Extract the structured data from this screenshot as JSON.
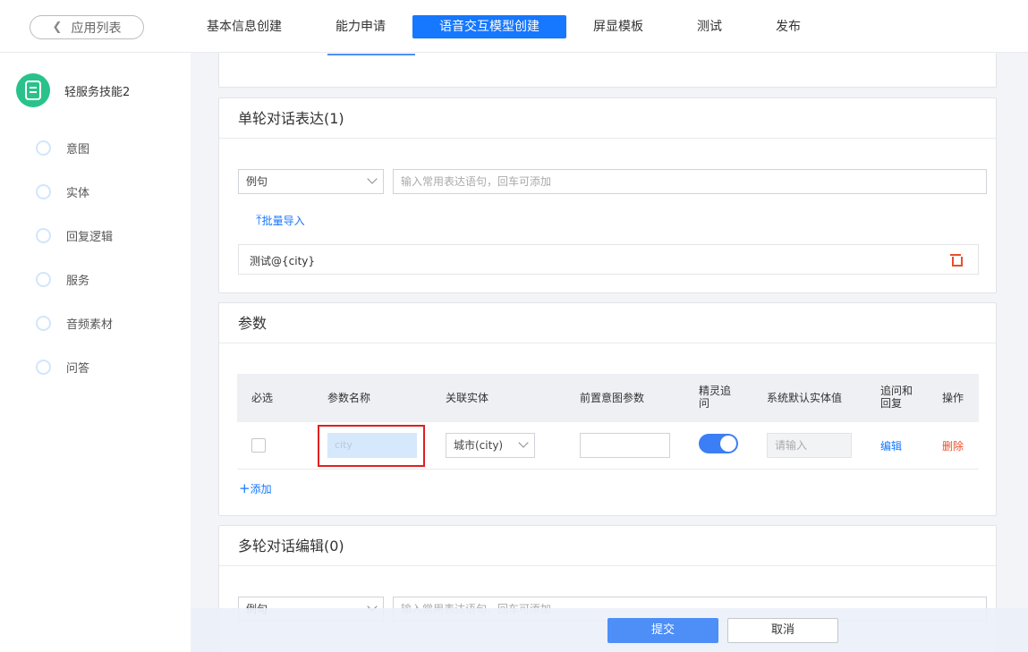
{
  "header": {
    "back_label": "应用列表",
    "tabs": [
      {
        "label": "基本信息创建"
      },
      {
        "label": "能力申请"
      },
      {
        "label": "语音交互模型创建"
      },
      {
        "label": "屏显模板"
      },
      {
        "label": "测试"
      },
      {
        "label": "发布"
      }
    ],
    "active_tab": "语音交互模型创建"
  },
  "sidebar": {
    "app_name": "轻服务技能2",
    "items": [
      {
        "label": "意图"
      },
      {
        "label": "实体"
      },
      {
        "label": "回复逻辑"
      },
      {
        "label": "服务"
      },
      {
        "label": "音频素材"
      },
      {
        "label": "问答"
      }
    ]
  },
  "single_turn": {
    "title": "单轮对话表达(1)",
    "type_select": "例句",
    "input_placeholder": "输入常用表达语句，回车可添加",
    "batch_import": "批量导入",
    "expressions": [
      "测试@{city}"
    ]
  },
  "params": {
    "title": "参数",
    "columns": [
      "必选",
      "参数名称",
      "关联实体",
      "前置意图参数",
      "精灵追问",
      "系统默认实体值",
      "追问和回复",
      "操作"
    ],
    "rows": [
      {
        "required": false,
        "name_placeholder": "city",
        "entity": "城市(city)",
        "pre_intent_param": "",
        "follow_up": true,
        "default_placeholder": "请输入",
        "edit": "编辑",
        "delete": "删除"
      }
    ],
    "add_label": "添加"
  },
  "multi_turn": {
    "title": "多轮对话编辑(0)",
    "type_select": "例句",
    "input_placeholder": "输入常用表达语句，回车可添加"
  },
  "footer": {
    "submit": "提交",
    "cancel": "取消"
  },
  "colors": {
    "accent": "#1677ff",
    "danger": "#e8502a",
    "logo": "#29c28a",
    "highlight_box": "#e02020"
  }
}
